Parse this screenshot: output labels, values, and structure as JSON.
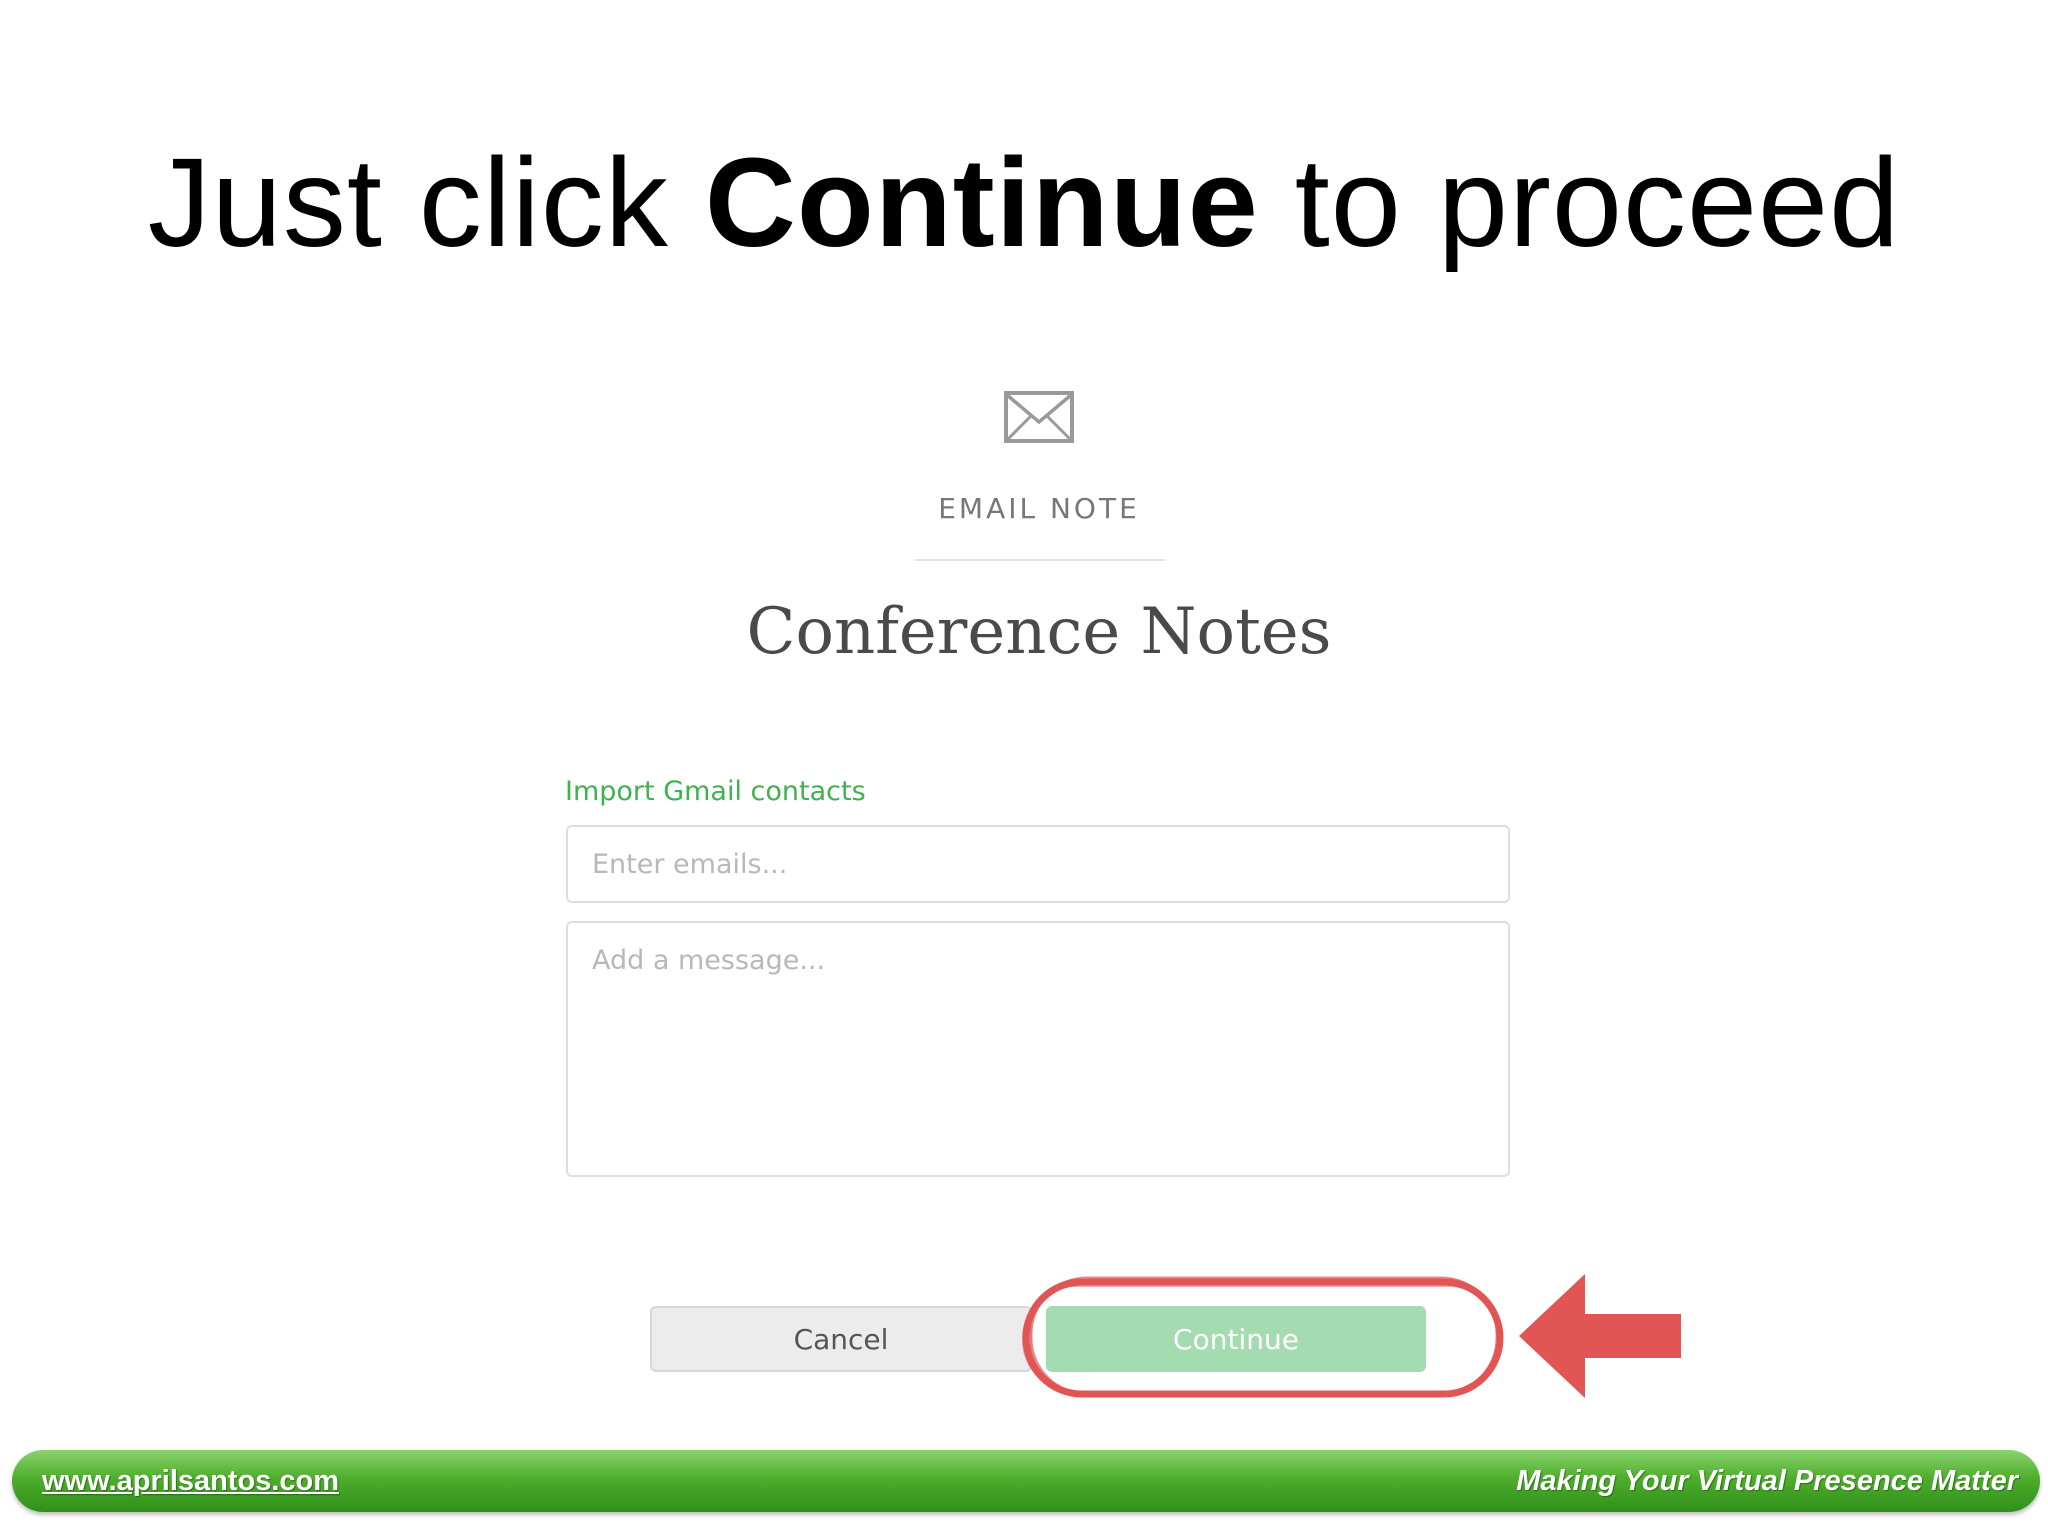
{
  "headline": {
    "prefix": "Just click ",
    "emphasis": "Continue",
    "suffix": " to proceed"
  },
  "dialog": {
    "icon": "envelope-icon",
    "header_label": "EMAIL NOTE",
    "note_title": "Conference Notes",
    "import_link": "Import Gmail contacts",
    "emails_placeholder": "Enter emails...",
    "message_placeholder": "Add a message...",
    "cancel_label": "Cancel",
    "continue_label": "Continue"
  },
  "annotation": {
    "highlight_color": "#e25555",
    "arrow_color": "#e25555",
    "arrow_icon": "left-arrow-icon"
  },
  "footer": {
    "url": "www.aprilsantos.com",
    "tagline": "Making Your Virtual Presence Matter"
  },
  "colors": {
    "accent_green": "#3fb24f",
    "continue_disabled_green": "#a5dbb0",
    "footer_green": "#4fae2c"
  }
}
